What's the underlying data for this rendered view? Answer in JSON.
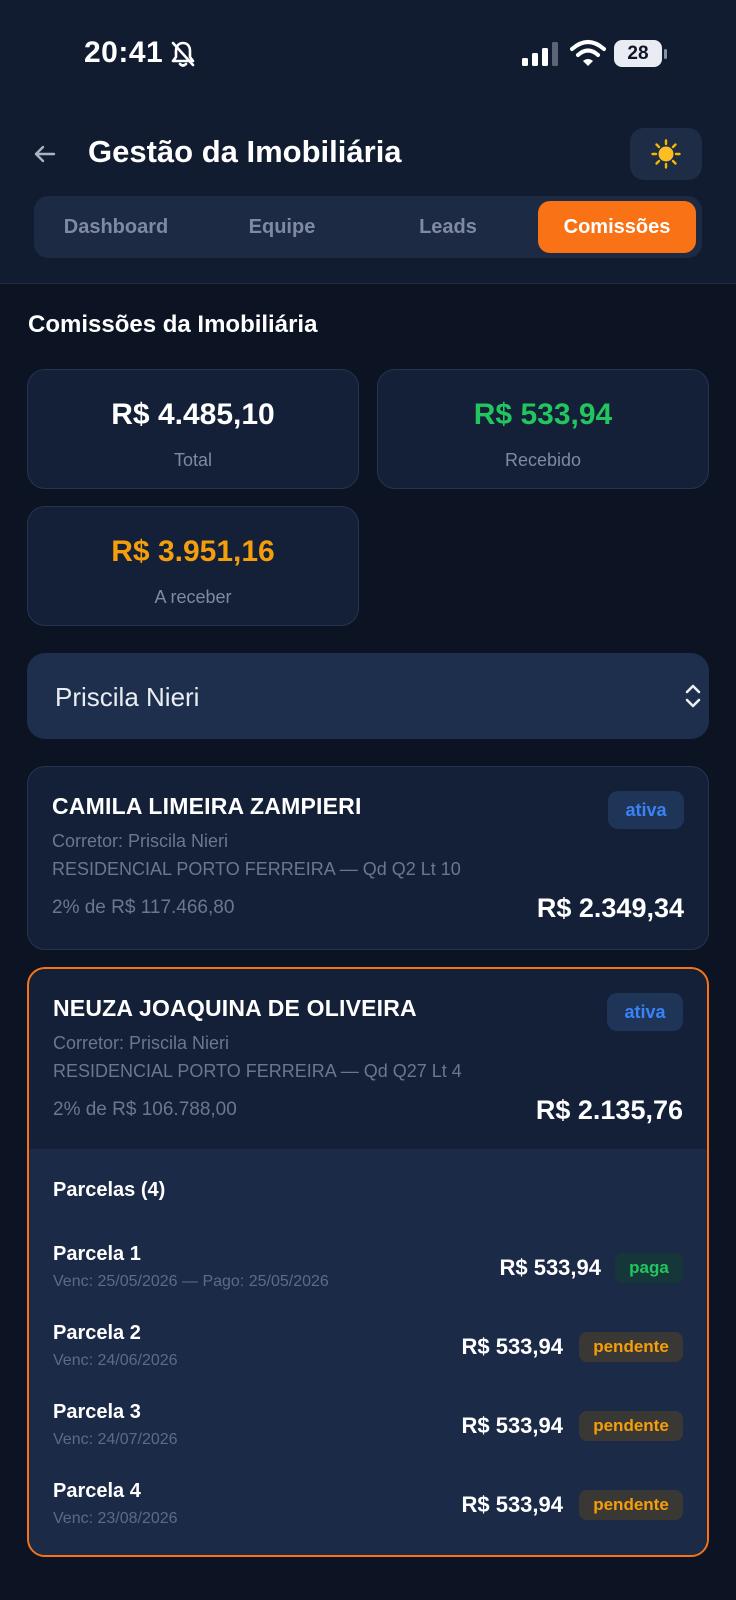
{
  "status_bar": {
    "time": "20:41",
    "battery": "28"
  },
  "header": {
    "title": "Gestão da Imobiliária"
  },
  "tabs": [
    {
      "label": "Dashboard"
    },
    {
      "label": "Equipe"
    },
    {
      "label": "Leads"
    },
    {
      "label": "Comissões",
      "active": true
    }
  ],
  "section": {
    "title": "Comissões da Imobiliária"
  },
  "summary": {
    "total": {
      "value": "R$ 4.485,10",
      "label": "Total",
      "color": "#ffffff"
    },
    "recebido": {
      "value": "R$ 533,94",
      "label": "Recebido",
      "color": "#22c55e"
    },
    "a_receber": {
      "value": "R$ 3.951,16",
      "label": "A receber",
      "color": "#f59e0b"
    }
  },
  "broker_select": {
    "value": "Priscila Nieri"
  },
  "commissions": [
    {
      "client": "CAMILA LIMEIRA ZAMPIERI",
      "status": "ativa",
      "broker": "Corretor: Priscila Nieri",
      "property": "RESIDENCIAL PORTO FERREIRA — Qd Q2 Lt 10",
      "rate": "2% de R$ 117.466,80",
      "amount": "R$ 2.349,34"
    },
    {
      "client": "NEUZA JOAQUINA DE OLIVEIRA",
      "status": "ativa",
      "broker": "Corretor: Priscila Nieri",
      "property": "RESIDENCIAL PORTO FERREIRA — Qd Q27 Lt 4",
      "rate": "2% de R$ 106.788,00",
      "amount": "R$ 2.135,76",
      "installments_title": "Parcelas (4)",
      "installments": [
        {
          "name": "Parcela 1",
          "dates": "Venc: 25/05/2026 — Pago: 25/05/2026",
          "amount": "R$ 533,94",
          "status": "paga"
        },
        {
          "name": "Parcela 2",
          "dates": "Venc: 24/06/2026",
          "amount": "R$ 533,94",
          "status": "pendente"
        },
        {
          "name": "Parcela 3",
          "dates": "Venc: 24/07/2026",
          "amount": "R$ 533,94",
          "status": "pendente"
        },
        {
          "name": "Parcela 4",
          "dates": "Venc: 23/08/2026",
          "amount": "R$ 533,94",
          "status": "pendente"
        }
      ]
    }
  ],
  "colors": {
    "accent": "#f97316",
    "background": "#0c1424",
    "card": "#132038",
    "success": "#22c55e",
    "warning": "#f59e0b",
    "info": "#3b82f6"
  },
  "icons": {
    "back": "arrow-left-icon",
    "theme": "sun-icon",
    "select": "chevron-up-down-icon",
    "status": [
      "bell-off-icon",
      "signal-icon",
      "wifi-icon",
      "battery-icon"
    ]
  }
}
